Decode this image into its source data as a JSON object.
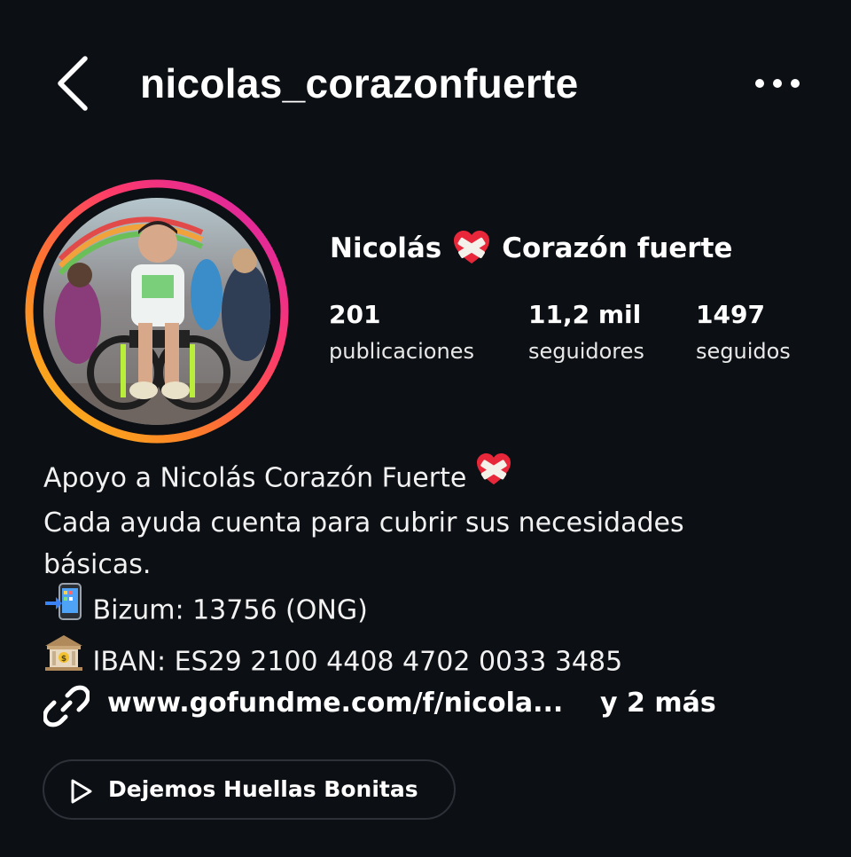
{
  "header": {
    "username": "nicolas_corazonfuerte",
    "back_icon": "chevron-left-icon",
    "more_icon": "more-horizontal-icon"
  },
  "profile": {
    "name_first": "Nicolás",
    "name_emoji": "mending-heart-emoji",
    "name_rest": "Corazón fuerte",
    "story_ring_colors": [
      "#f9c412",
      "#fd5949",
      "#d6249f",
      "#c13584"
    ]
  },
  "stats": {
    "posts_value": "201",
    "posts_label": "publicaciones",
    "followers_value": "11,2 mil",
    "followers_label": "seguidores",
    "following_value": "1497",
    "following_label": "seguidos"
  },
  "bio": {
    "line1": "Apoyo a Nicolás Corazón Fuerte",
    "line2": "Cada ayuda cuenta para cubrir sus necesidades",
    "line3": "básicas.",
    "line4": "Bizum: 13756 (ONG)",
    "line5": "IBAN: ES29 2100 4408 4702 0033 3485",
    "phone_emoji": "mobile-phone-arrow-emoji",
    "bank_emoji": "bank-emoji"
  },
  "link": {
    "url": "www.gofundme.com/f/nicola...",
    "more": "y 2 más",
    "icon": "link-icon"
  },
  "reel_pill": {
    "label": "Dejemos Huellas Bonitas",
    "icon": "play-icon"
  }
}
